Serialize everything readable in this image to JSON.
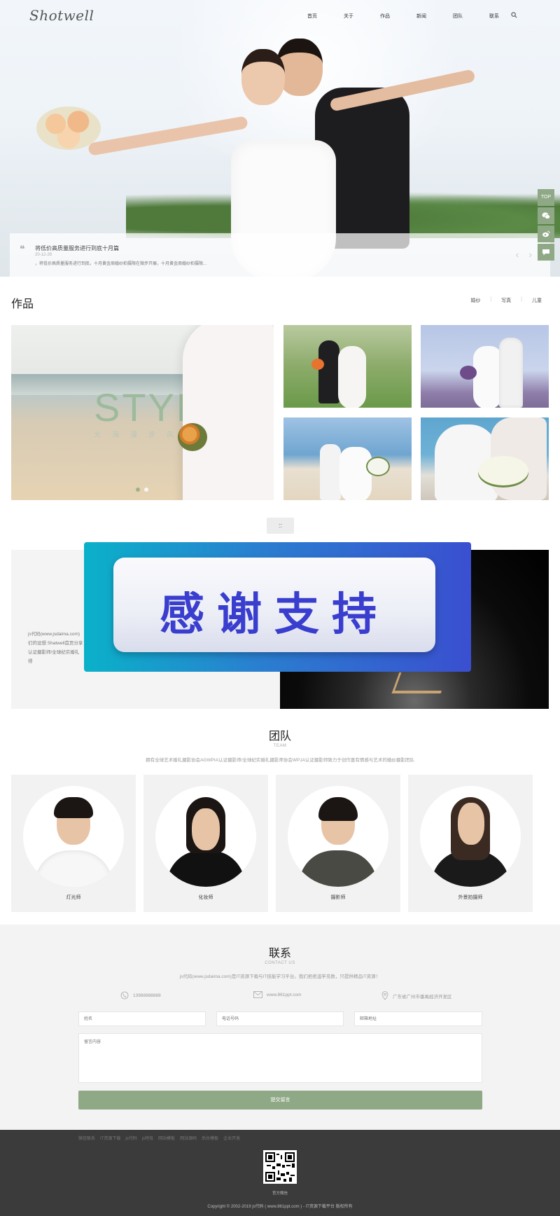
{
  "brand": {
    "logo": "Shotwell"
  },
  "nav": {
    "items": [
      "首页",
      "关于",
      "作品",
      "新闻",
      "团队",
      "联系"
    ]
  },
  "hero": {
    "caption_title": "将低价高质量服务进行到底十月篇",
    "caption_date": "20-12-29",
    "caption_desc": "，将低价高质量服务进行到底，十月黄金周婚纱拍摄限在微步开展，十月黄金周婚纱拍摄限..."
  },
  "side_tools": {
    "top_label": "TOP"
  },
  "works": {
    "title": "作品",
    "categories": [
      "婚纱",
      "写真",
      "儿童"
    ],
    "featured_text": "STYLE",
    "featured_subtext": "大海漫步风格",
    "more_label": "::"
  },
  "about": {
    "text": "js代码(www.jsdaima.com)\n们的设想 Shatwell首页分享\n认证摄影师/全球纪实婚礼\n得"
  },
  "banner": {
    "text": "感谢支持"
  },
  "team": {
    "title": "团队",
    "subtitle": "TEAM",
    "desc": "拥有全球艺术婚礼摄影协会AGWPIA认证摄影师/全球纪实婚礼摄影师协会WPJA认证摄影师致力于创作富有情感与艺术的婚纱摄影团队",
    "members": [
      {
        "role": "灯光师"
      },
      {
        "role": "化妆师"
      },
      {
        "role": "摄影师"
      },
      {
        "role": "外景拍摄师"
      }
    ]
  },
  "contact": {
    "title": "联系",
    "subtitle": "CONTACT US",
    "desc": "js代码(www.jsdaima.com)是IT资源下载与IT技能学习平台。我们拒绝滥竽充数，只提供精品IT资源！",
    "phone": "13988888888",
    "email": "www.861ppt.com",
    "address": "广东省广州市番禺经济开发区",
    "name_placeholder": "姓名",
    "tel_placeholder": "电话号码",
    "mail_placeholder": "邮箱地址",
    "message_placeholder": "留言内容",
    "submit_label": "提交留言"
  },
  "footer": {
    "links": [
      "微信联系",
      "IT资源下载",
      "js代码",
      "js特效",
      "网站模板",
      "网站源码",
      "后台模板",
      "企业开发"
    ],
    "qr_label": "官方微信",
    "copyright": "Copyright © 2002-2019 js代码 ( www.861ppt.com ) - IT资源下载平台 版权所有"
  },
  "colors": {
    "accent": "#8fa886",
    "footer_bg": "#3b3b3b",
    "banner_text": "#3a3ecf"
  }
}
